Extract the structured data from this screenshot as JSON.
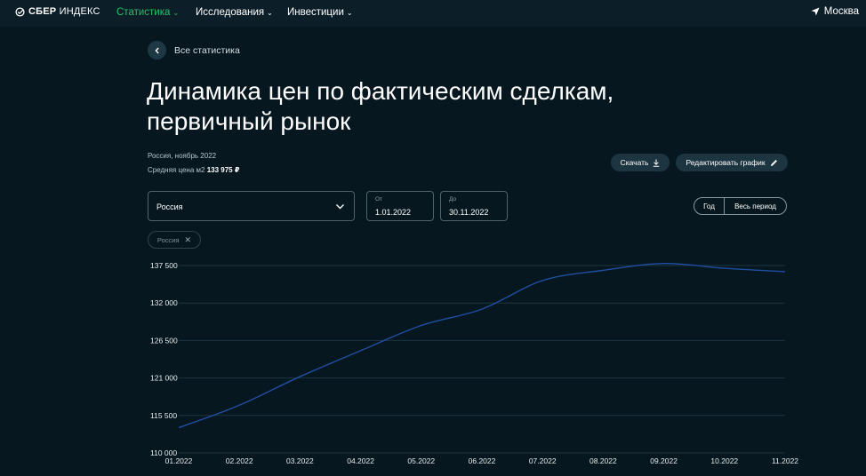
{
  "header": {
    "logo_bold": "СБЕР",
    "logo_light": "ИНДЕКС",
    "nav": [
      {
        "label": "Статистика",
        "active": true
      },
      {
        "label": "Исследования",
        "active": false
      },
      {
        "label": "Инвестиции",
        "active": false
      }
    ],
    "city": "Москва"
  },
  "breadcrumb": {
    "back_label": "Все статистика"
  },
  "page": {
    "title_line1": "Динамика цен по фактическим сделкам,",
    "title_line2": "первичный рынок",
    "region_date": "Россия, ноябрь 2022",
    "avg_price_label": "Средняя цена м2",
    "avg_price_value": "133 975 ₽"
  },
  "actions": {
    "download_label": "Скачать",
    "edit_label": "Редактировать график"
  },
  "filters": {
    "region_value": "Россия",
    "from_label": "От",
    "from_value": "1.01.2022",
    "to_label": "До",
    "to_value": "30.11.2022",
    "period_year": "Год",
    "period_all": "Весь период",
    "chip_label": "Россия"
  },
  "colors": {
    "background": "#06171f",
    "accent_green": "#21c16b",
    "line": "#1f4ea3",
    "grid": "#1e3541"
  },
  "chart_data": {
    "type": "line",
    "x": [
      "01.2022",
      "02.2022",
      "03.2022",
      "04.2022",
      "05.2022",
      "06.2022",
      "07.2022",
      "08.2022",
      "09.2022",
      "10.2022",
      "11.2022"
    ],
    "series": [
      {
        "values": [
          113700,
          117000,
          121200,
          125000,
          128700,
          131100,
          135300,
          136800,
          137800,
          137100,
          136600
        ]
      }
    ],
    "ylim": [
      110000,
      137500
    ],
    "yticks": [
      110000,
      115500,
      121000,
      126500,
      132000,
      137500
    ],
    "ytick_labels": [
      "110 000",
      "115 500",
      "121 000",
      "126 500",
      "132 000",
      "137 500"
    ],
    "grid": true
  }
}
